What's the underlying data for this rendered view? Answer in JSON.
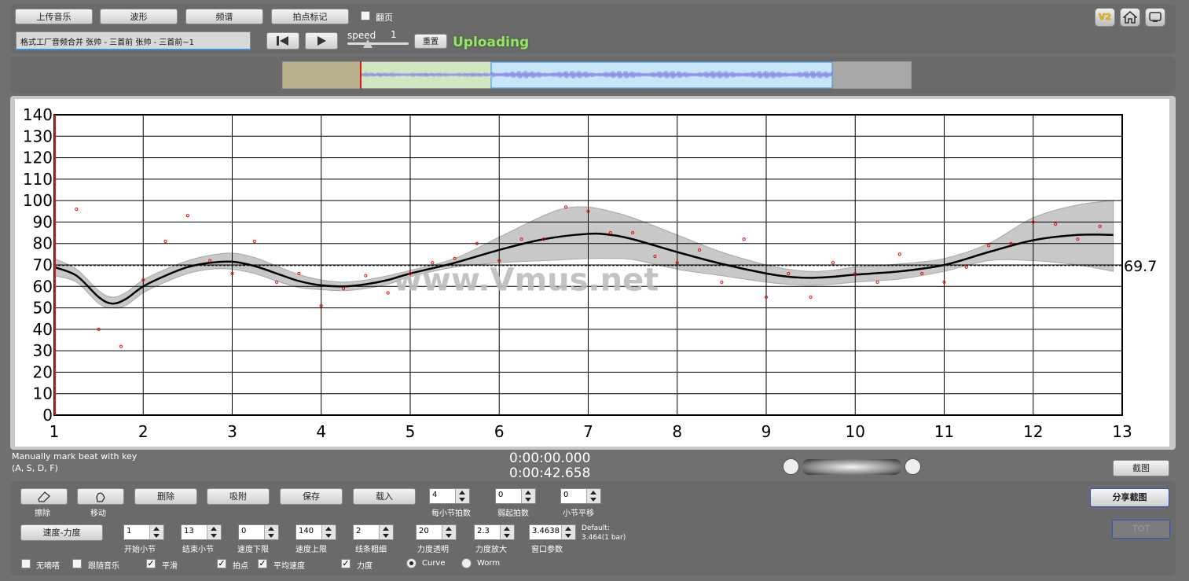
{
  "toolbar": {
    "upload_music": "上传音乐",
    "waveform": "波形",
    "spectrum": "频谱",
    "beat_mark": "拍点标记",
    "page_turn": "翻页",
    "file_name": "格式工厂音频合并 张帅 - 三首前 张帅 - 三首前~1",
    "speed_label": "speed",
    "speed_value": "1",
    "reset": "重置",
    "status": "Uploading",
    "v2": "V2",
    "home_icon": "home-icon",
    "window_icon": "window-icon"
  },
  "overview": {
    "played_color": "#b8b08a",
    "selection_color": "#cfe8c0",
    "view_color": "#c8e6f8"
  },
  "chart_data": {
    "type": "line",
    "title": "",
    "xlabel": "",
    "ylabel": "",
    "xlim": [
      1,
      13
    ],
    "ylim": [
      0,
      140
    ],
    "x_ticks": [
      1,
      2,
      3,
      4,
      5,
      6,
      7,
      8,
      9,
      10,
      11,
      12,
      13
    ],
    "y_ticks": [
      0,
      10,
      20,
      30,
      40,
      50,
      60,
      70,
      80,
      90,
      100,
      110,
      120,
      130,
      140
    ],
    "grid": true,
    "average_value": 69.7,
    "average_label": "69.7",
    "watermark": "www.Vmus.net",
    "smooth_curve": [
      [
        1,
        69
      ],
      [
        1.25,
        65
      ],
      [
        1.5,
        55
      ],
      [
        1.65,
        52
      ],
      [
        1.8,
        54
      ],
      [
        2,
        60
      ],
      [
        2.25,
        65
      ],
      [
        2.5,
        69
      ],
      [
        2.75,
        71
      ],
      [
        3,
        71.5
      ],
      [
        3.25,
        69.5
      ],
      [
        3.5,
        66
      ],
      [
        3.75,
        62.5
      ],
      [
        4,
        60.5
      ],
      [
        4.25,
        60
      ],
      [
        4.5,
        61
      ],
      [
        4.75,
        63
      ],
      [
        5,
        66
      ],
      [
        5.5,
        71
      ],
      [
        6,
        77
      ],
      [
        6.5,
        82
      ],
      [
        7,
        84.5
      ],
      [
        7.25,
        84
      ],
      [
        7.5,
        82
      ],
      [
        8,
        76
      ],
      [
        8.5,
        70.5
      ],
      [
        9,
        66
      ],
      [
        9.25,
        64.5
      ],
      [
        9.5,
        64
      ],
      [
        9.75,
        64.5
      ],
      [
        10,
        65.5
      ],
      [
        10.5,
        67
      ],
      [
        11,
        70
      ],
      [
        11.5,
        76
      ],
      [
        12,
        81.5
      ],
      [
        12.5,
        84
      ],
      [
        12.9,
        84
      ]
    ],
    "band_upper": [
      [
        1,
        73
      ],
      [
        1.25,
        68
      ],
      [
        1.5,
        58
      ],
      [
        1.65,
        55
      ],
      [
        1.8,
        57
      ],
      [
        2,
        63
      ],
      [
        2.25,
        68
      ],
      [
        2.5,
        72
      ],
      [
        2.75,
        74.5
      ],
      [
        3,
        75.5
      ],
      [
        3.25,
        73.5
      ],
      [
        3.5,
        69.5
      ],
      [
        3.75,
        65.5
      ],
      [
        4,
        63
      ],
      [
        4.25,
        62
      ],
      [
        4.5,
        63
      ],
      [
        4.75,
        65
      ],
      [
        5,
        67.5
      ],
      [
        5.5,
        73
      ],
      [
        6,
        83
      ],
      [
        6.5,
        93
      ],
      [
        6.75,
        96.5
      ],
      [
        7,
        97
      ],
      [
        7.25,
        95
      ],
      [
        7.5,
        92
      ],
      [
        8,
        84
      ],
      [
        8.5,
        76
      ],
      [
        9,
        70
      ],
      [
        9.25,
        68
      ],
      [
        9.5,
        67
      ],
      [
        9.75,
        67.5
      ],
      [
        10,
        69
      ],
      [
        10.5,
        70.5
      ],
      [
        11,
        73
      ],
      [
        11.5,
        80
      ],
      [
        12,
        92
      ],
      [
        12.5,
        98
      ],
      [
        12.9,
        100
      ]
    ],
    "band_lower": [
      [
        1,
        65
      ],
      [
        1.25,
        62
      ],
      [
        1.5,
        52
      ],
      [
        1.65,
        50
      ],
      [
        1.8,
        51
      ],
      [
        2,
        57
      ],
      [
        2.25,
        62
      ],
      [
        2.5,
        66
      ],
      [
        2.75,
        68
      ],
      [
        3,
        68
      ],
      [
        3.25,
        66
      ],
      [
        3.5,
        62.5
      ],
      [
        3.75,
        59.5
      ],
      [
        4,
        58.5
      ],
      [
        4.25,
        58
      ],
      [
        4.5,
        59
      ],
      [
        4.75,
        61
      ],
      [
        5,
        64.5
      ],
      [
        5.5,
        69
      ],
      [
        6,
        71
      ],
      [
        6.5,
        72
      ],
      [
        6.75,
        72.5
      ],
      [
        7,
        73
      ],
      [
        7.25,
        73
      ],
      [
        7.5,
        72.5
      ],
      [
        8,
        68
      ],
      [
        8.5,
        65
      ],
      [
        9,
        62
      ],
      [
        9.25,
        61
      ],
      [
        9.5,
        60.5
      ],
      [
        9.75,
        61
      ],
      [
        10,
        62
      ],
      [
        10.5,
        63.5
      ],
      [
        11,
        67
      ],
      [
        11.5,
        72
      ],
      [
        12,
        72
      ],
      [
        12.5,
        70
      ],
      [
        12.9,
        67
      ]
    ],
    "beat_points": [
      [
        1.25,
        96
      ],
      [
        1.5,
        40
      ],
      [
        1.75,
        32
      ],
      [
        2,
        63
      ],
      [
        2.25,
        81
      ],
      [
        2.5,
        93
      ],
      [
        2.75,
        72
      ],
      [
        3,
        66
      ],
      [
        3.25,
        81
      ],
      [
        3.5,
        62
      ],
      [
        3.75,
        66
      ],
      [
        4,
        51
      ],
      [
        4.25,
        59
      ],
      [
        4.5,
        65
      ],
      [
        4.75,
        57
      ],
      [
        5,
        66
      ],
      [
        5.25,
        71
      ],
      [
        5.5,
        73
      ],
      [
        5.75,
        80
      ],
      [
        6,
        72
      ],
      [
        6.25,
        82
      ],
      [
        6.5,
        82
      ],
      [
        6.75,
        97
      ],
      [
        7,
        95
      ],
      [
        7.25,
        85
      ],
      [
        7.5,
        85
      ],
      [
        7.75,
        74
      ],
      [
        8,
        71
      ],
      [
        8.25,
        77
      ],
      [
        8.5,
        62
      ],
      [
        8.75,
        82
      ],
      [
        9,
        55
      ],
      [
        9.25,
        66
      ],
      [
        9.5,
        55
      ],
      [
        9.75,
        71
      ],
      [
        10,
        66
      ],
      [
        10.25,
        62
      ],
      [
        10.5,
        75
      ],
      [
        10.75,
        66
      ],
      [
        11,
        62
      ],
      [
        11.25,
        69
      ],
      [
        11.5,
        79
      ],
      [
        11.75,
        80
      ],
      [
        12,
        90
      ],
      [
        12.25,
        89
      ],
      [
        12.5,
        82
      ],
      [
        12.75,
        88
      ]
    ]
  },
  "status_area": {
    "hint_line1": "Manually mark beat with key",
    "hint_line2": "(A, S, D, F)",
    "current_time": "0:00:00.000",
    "total_time": "0:00:42.658",
    "screenshot": "截图",
    "share_screenshot": "分享截图",
    "tot": "TOT"
  },
  "controls": {
    "erase": "擦除",
    "move": "移动",
    "delete": "删除",
    "snap": "吸附",
    "save": "保存",
    "load": "载入",
    "beats_per_bar_label": "每小节拍数",
    "beats_per_bar": "4",
    "pickup_label": "弱起拍数",
    "pickup": "0",
    "bar_shift_label": "小节平移",
    "bar_shift": "0",
    "tempo_dynamics": "速度-力度",
    "start_bar_label": "开始小节",
    "start_bar": "1",
    "end_bar_label": "结束小节",
    "end_bar": "13",
    "tempo_min_label": "速度下限",
    "tempo_min": "0",
    "tempo_max_label": "速度上限",
    "tempo_max": "140",
    "line_width_label": "线条粗细",
    "line_width": "2",
    "dyn_alpha_label": "力度透明",
    "dyn_alpha": "20",
    "dyn_scale_label": "力度放大",
    "dyn_scale": "2.3",
    "window_label": "窗口参数",
    "window_value": "3.4638",
    "default_line1": "Default:",
    "default_line2": "3.464(1 bar)",
    "no_sound": "无嘀嗒",
    "follow_music": "跟随音乐",
    "smooth": "平滑",
    "beat_point": "拍点",
    "avg_tempo": "平均速度",
    "dynamics": "力度",
    "curve": "Curve",
    "worm": "Worm"
  }
}
